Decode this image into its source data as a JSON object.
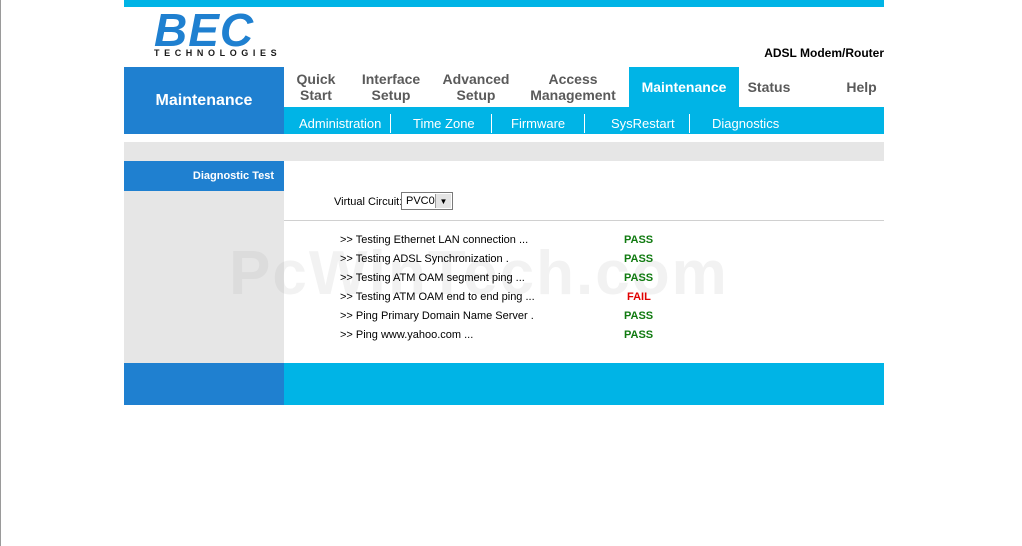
{
  "brand": {
    "logo_text": "BEC",
    "logo_subtext": "TECHNOLOGIES",
    "product": "ADSL Modem/Router"
  },
  "section_title": "Maintenance",
  "tabs": [
    {
      "label": "Quick\nStart"
    },
    {
      "label": "Interface\nSetup"
    },
    {
      "label": "Advanced\nSetup"
    },
    {
      "label": "Access\nManagement"
    },
    {
      "label": "Maintenance",
      "active": true
    },
    {
      "label": "Status"
    },
    {
      "label": "Help"
    }
  ],
  "subnav": [
    {
      "label": "Administration"
    },
    {
      "label": "Time Zone"
    },
    {
      "label": "Firmware"
    },
    {
      "label": "SysRestart"
    },
    {
      "label": "Diagnostics"
    }
  ],
  "sidebar": {
    "heading": "Diagnostic Test"
  },
  "virtual_circuit": {
    "label": "Virtual Circuit:",
    "value": "PVC0"
  },
  "tests": [
    {
      "label": ">> Testing Ethernet LAN connection ...",
      "result": "PASS"
    },
    {
      "label": ">> Testing ADSL Synchronization .",
      "result": "PASS"
    },
    {
      "label": ">> Testing ATM OAM segment ping ...",
      "result": "PASS"
    },
    {
      "label": ">> Testing ATM OAM end to end ping ...",
      "result": "FAIL"
    },
    {
      "label": ">> Ping Primary Domain Name Server .",
      "result": "PASS"
    },
    {
      "label": ">> Ping www.yahoo.com ...",
      "result": "PASS"
    }
  ],
  "watermark": "PcWinTech.com",
  "colors": {
    "accent": "#00b4e6",
    "dark_blue": "#1f80d0",
    "pass": "#107a10",
    "fail": "#e00000"
  }
}
